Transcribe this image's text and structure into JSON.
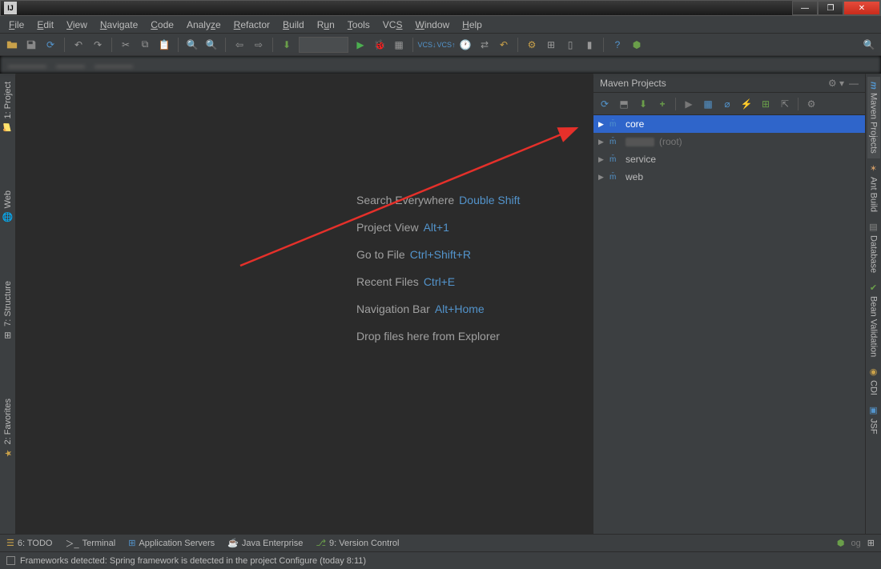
{
  "menu": [
    "File",
    "Edit",
    "View",
    "Navigate",
    "Code",
    "Analyze",
    "Refactor",
    "Build",
    "Run",
    "Tools",
    "VCS",
    "Window",
    "Help"
  ],
  "leftTabs": [
    {
      "label": "1: Project"
    },
    {
      "label": "Web"
    },
    {
      "label": "7: Structure"
    },
    {
      "label": "2: Favorites"
    }
  ],
  "welcome": [
    {
      "label": "Search Everywhere",
      "key": "Double Shift"
    },
    {
      "label": "Project View",
      "key": "Alt+1"
    },
    {
      "label": "Go to File",
      "key": "Ctrl+Shift+R"
    },
    {
      "label": "Recent Files",
      "key": "Ctrl+E"
    },
    {
      "label": "Navigation Bar",
      "key": "Alt+Home"
    },
    {
      "label": "Drop files here from Explorer",
      "key": ""
    }
  ],
  "maven": {
    "title": "Maven Projects",
    "items": [
      {
        "name": "core",
        "selected": true,
        "suffix": ""
      },
      {
        "name": "",
        "selected": false,
        "suffix": "(root)",
        "masked": true
      },
      {
        "name": "service",
        "selected": false,
        "suffix": ""
      },
      {
        "name": "web",
        "selected": false,
        "suffix": ""
      }
    ]
  },
  "rightTabs": [
    "Maven Projects",
    "Ant Build",
    "Database",
    "Bean Validation",
    "CDI",
    "JSF"
  ],
  "bottomTabs": [
    {
      "icon": "todo",
      "label": "6: TODO"
    },
    {
      "icon": "term",
      "label": "Terminal"
    },
    {
      "icon": "apps",
      "label": "Application Servers"
    },
    {
      "icon": "jee",
      "label": "Java Enterprise"
    },
    {
      "icon": "vcs",
      "label": "9: Version Control"
    }
  ],
  "status": "Frameworks detected: Spring framework is detected in the project Configure (today 8:11)"
}
